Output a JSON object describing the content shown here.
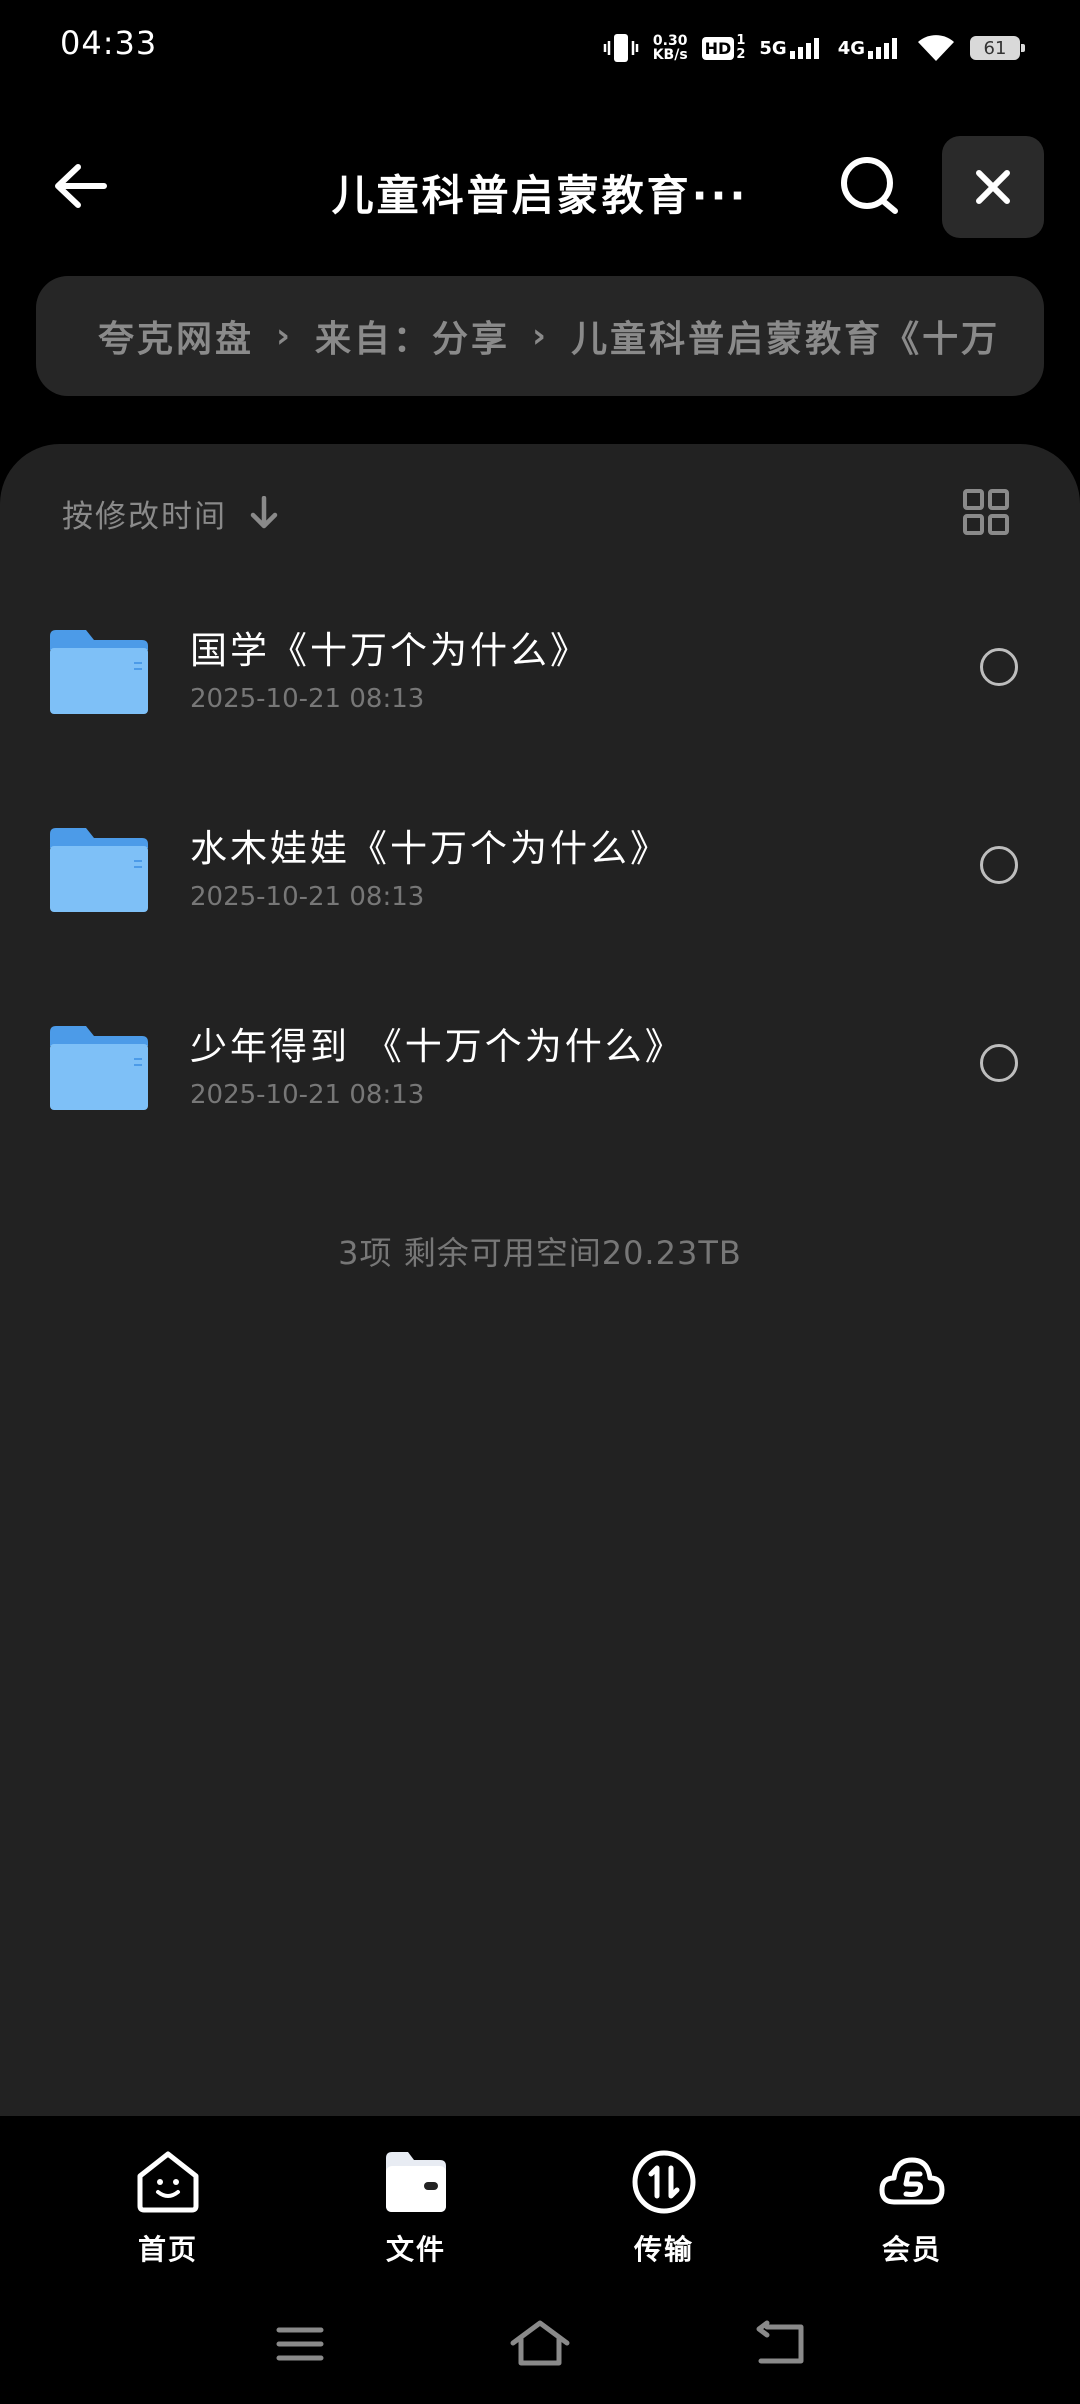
{
  "status_bar": {
    "time": "04:33",
    "net_speed_value": "0.30",
    "net_speed_unit": "KB/s",
    "hd_label": "HD",
    "sim1": "5G",
    "sim2": "4G",
    "battery": "61"
  },
  "header": {
    "title": "儿童科普启蒙教育···",
    "back_icon": "arrow-left-icon",
    "search_icon": "search-icon",
    "close_icon": "close-icon"
  },
  "breadcrumb": {
    "items": [
      "夸克网盘",
      "来自：分享",
      "儿童科普启蒙教育《十万"
    ],
    "separator": "›"
  },
  "sort": {
    "label": "按修改时间",
    "icon": "arrow-down-icon",
    "view_icon": "grid-view-icon"
  },
  "files": [
    {
      "name": "国学《十万个为什么》",
      "date": "2025-10-21 08:13",
      "icon": "folder-icon"
    },
    {
      "name": "水木娃娃《十万个为什么》",
      "date": "2025-10-21 08:13",
      "icon": "folder-icon"
    },
    {
      "name": "少年得到 《十万个为什么》",
      "date": "2025-10-21 08:13",
      "icon": "folder-icon"
    }
  ],
  "summary": "3项 剩余可用空间20.23TB",
  "tabs": [
    {
      "label": "首页",
      "icon": "home-smile-icon"
    },
    {
      "label": "文件",
      "icon": "folder-tab-icon",
      "active": true
    },
    {
      "label": "传输",
      "icon": "transfer-icon"
    },
    {
      "label": "会员",
      "icon": "vip-cloud-icon"
    }
  ],
  "nav": {
    "menu_icon": "menu-icon",
    "home_icon": "home-nav-icon",
    "back_icon": "back-nav-icon"
  },
  "colors": {
    "background": "#000000",
    "panel": "#222222",
    "breadcrumb_bg": "#262626",
    "folder_blue": "#5aa9f0",
    "muted_text": "#8a8a8a"
  }
}
